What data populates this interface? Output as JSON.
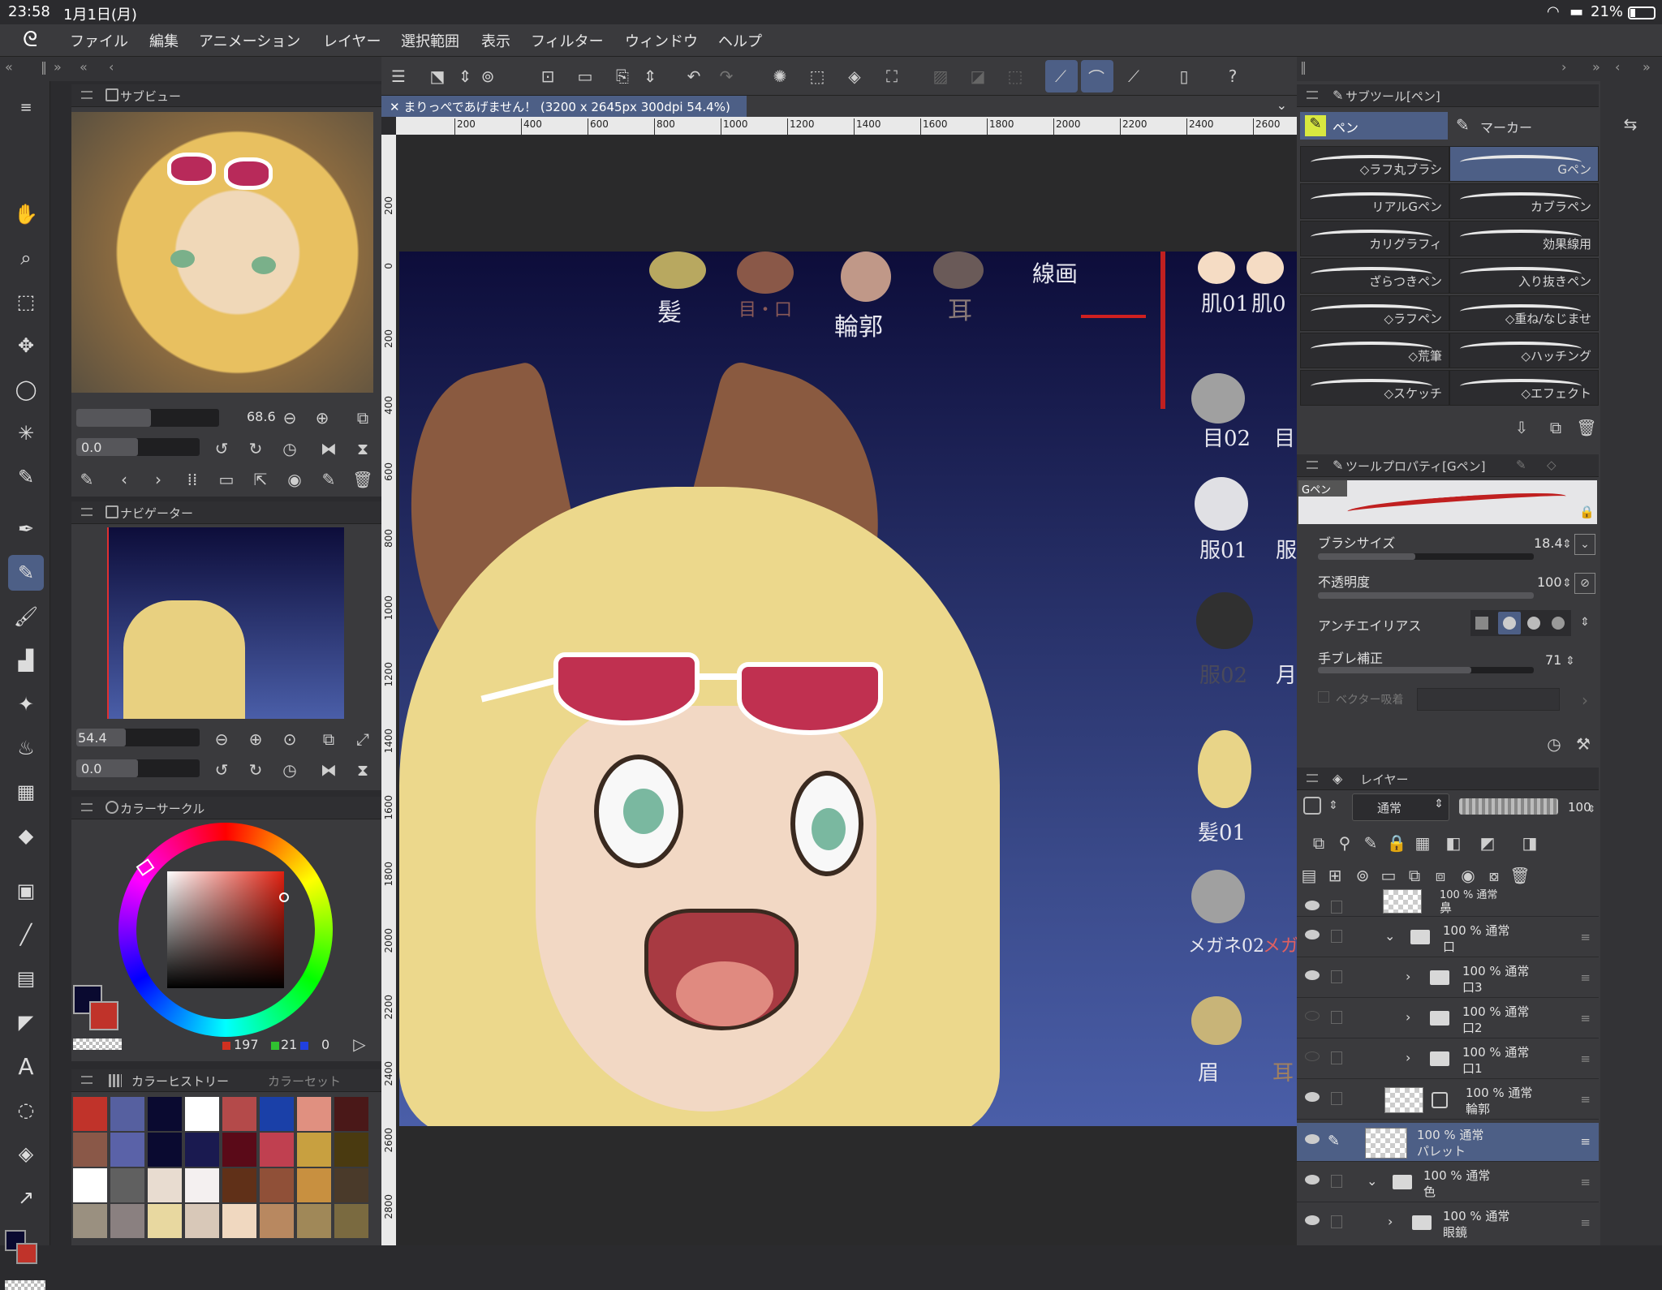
{
  "status": {
    "time": "23:58",
    "date": "1月1日(月)",
    "battery": "21%"
  },
  "menu": [
    "ファイル",
    "編集",
    "アニメーション",
    "レイヤー",
    "選択範囲",
    "表示",
    "フィルター",
    "ウィンドウ",
    "ヘルプ"
  ],
  "subview": {
    "title": "サブビュー",
    "zoom": "68.6",
    "rotate": "0.0"
  },
  "navigator": {
    "title": "ナビゲーター",
    "zoom": "54.4",
    "rotate": "0.0"
  },
  "colorcircle": {
    "title": "カラーサークル",
    "r": "197",
    "g": "21",
    "b": "0"
  },
  "history": {
    "tab1": "カラーヒストリー",
    "tab2": "カラーセット",
    "colors": [
      "#c0332a",
      "#5660a0",
      "#0a0a30",
      "#ffffff",
      "#b44a4a",
      "#1a40a8",
      "#e09080",
      "#4a1818",
      "#8a5848",
      "#5a62a8",
      "#0a0a30",
      "#1a1a50",
      "#5a0a18",
      "#c04050",
      "#c8a040",
      "#4a3a10",
      "#ffffff",
      "#606060",
      "#e8dcd0",
      "#f4f0f0",
      "#603018",
      "#905038",
      "#c89040",
      "#4a3a2a",
      "#9a9080",
      "#8a8080",
      "#e8d8a0",
      "#d8c8b8",
      "#f0d8c0",
      "#b88860",
      "#a08858",
      "#7a6a40"
    ]
  },
  "document": {
    "tab": "まりっぺであげません！ (3200 x 2645px 300dpi 54.4%)"
  },
  "ruler_h": [
    "200",
    "400",
    "600",
    "800",
    "1000",
    "1200",
    "1400",
    "1600",
    "1800",
    "2000",
    "2200",
    "2400",
    "2600"
  ],
  "ruler_v": [
    "200",
    "0",
    "200",
    "400",
    "600",
    "800",
    "1000",
    "1200",
    "1400",
    "1600",
    "1800",
    "2000",
    "2200",
    "2400",
    "2600",
    "2800"
  ],
  "art": {
    "labels": [
      "髪",
      "目・口",
      "輪郭",
      "耳",
      "線画",
      "肌01",
      "肌0",
      "目02",
      "目",
      "服01",
      "服",
      "服02",
      "月",
      "髪01",
      "メガネ02",
      "メガ",
      "眉",
      "耳"
    ]
  },
  "subtool": {
    "title": "サブツール[ペン]",
    "tab_pen": "ペン",
    "tab_marker": "マーカー",
    "brushes": [
      "◇ラフ丸ブラシ",
      "Gペン",
      "リアルGペン",
      "カブラペン",
      "カリグラフィ",
      "効果線用",
      "ざらつきペン",
      "入り抜きペン",
      "◇ラフペン",
      "◇重ね/なじませ",
      "◇荒筆",
      "◇ハッチング",
      "◇スケッチ",
      "◇エフェクト"
    ]
  },
  "toolprop": {
    "title": "ツールプロパティ[Gペン]",
    "brush_name": "Gペン",
    "size_label": "ブラシサイズ",
    "size_val": "18.4",
    "opacity_label": "不透明度",
    "opacity_val": "100",
    "aa_label": "アンチエイリアス",
    "stab_label": "手ブレ補正",
    "stab_val": "71",
    "vector_label": "ベクター吸着"
  },
  "layers": {
    "title": "レイヤー",
    "blend": "通常",
    "opacity": "100",
    "rows": [
      {
        "t1": "100 % 通常",
        "t2": "鼻"
      },
      {
        "t1": "100 % 通常",
        "t2": "口"
      },
      {
        "t1": "100 % 通常",
        "t2": "口3"
      },
      {
        "t1": "100 % 通常",
        "t2": "口2"
      },
      {
        "t1": "100 % 通常",
        "t2": "口1"
      },
      {
        "t1": "100 % 通常",
        "t2": "輪郭"
      },
      {
        "t1": "100 % 通常",
        "t2": "パレット"
      },
      {
        "t1": "100 % 通常",
        "t2": "色"
      },
      {
        "t1": "100 % 通常",
        "t2": "眼鏡"
      }
    ]
  }
}
